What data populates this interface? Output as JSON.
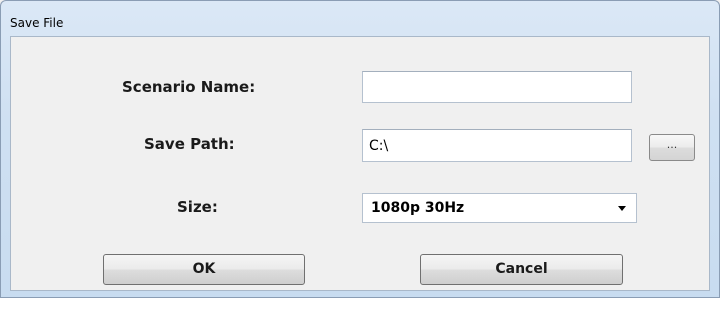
{
  "window": {
    "title": "Save File"
  },
  "form": {
    "scenario_name_label": "Scenario Name:",
    "scenario_name_value": "",
    "save_path_label": "Save Path:",
    "save_path_value": "C:\\",
    "browse_label": "...",
    "size_label": "Size:",
    "size_value": "1080p 30Hz"
  },
  "buttons": {
    "ok_label": "OK",
    "cancel_label": "Cancel"
  },
  "icons": {
    "dropdown": "chevron-down-icon"
  }
}
